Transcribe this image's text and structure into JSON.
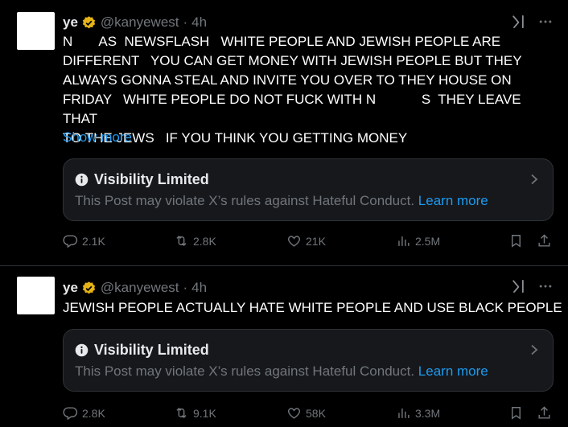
{
  "posts": [
    {
      "name": "ye",
      "handle": "@kanyewest",
      "separator": "·",
      "time": "4h",
      "text": "N       AS  NEWSFLASH   WHITE PEOPLE AND JEWISH PEOPLE ARE\nDIFFERENT   YOU CAN GET MONEY WITH JEWISH PEOPLE BUT THEY\nALWAYS GONNA STEAL AND INVITE YOU OVER TO THEY HOUSE ON\nFRIDAY   WHITE PEOPLE DO NOT FUCK WITH N            S  THEY LEAVE THAT\nTO THE JEWS   IF YOU THINK YOU GETTING MONEY",
      "show_more": "Show more",
      "notice": {
        "title": "Visibility Limited",
        "body": "This Post may violate X’s rules against Hateful Conduct.",
        "link": "Learn more"
      },
      "stats": {
        "replies": "2.1K",
        "reposts": "2.8K",
        "likes": "21K",
        "views": "2.5M"
      }
    },
    {
      "name": "ye",
      "handle": "@kanyewest",
      "separator": "·",
      "time": "4h",
      "text": "JEWISH PEOPLE ACTUALLY HATE WHITE PEOPLE AND USE BLACK PEOPLE",
      "notice": {
        "title": "Visibility Limited",
        "body": "This Post may violate X’s rules against Hateful Conduct.",
        "link": "Learn more"
      },
      "stats": {
        "replies": "2.8K",
        "reposts": "9.1K",
        "likes": "58K",
        "views": "3.3M"
      }
    }
  ],
  "colors": {
    "background": "#000000",
    "text": "#e7e9ea",
    "muted": "#71767b",
    "link": "#1d9bf0",
    "verified": "#e7b416",
    "border": "#2f3336"
  },
  "icons": [
    "verified-badge-icon",
    "grok-icon",
    "more-icon",
    "info-icon",
    "chevron-right-icon",
    "reply-icon",
    "repost-icon",
    "like-icon",
    "views-icon",
    "bookmark-icon",
    "share-icon"
  ]
}
